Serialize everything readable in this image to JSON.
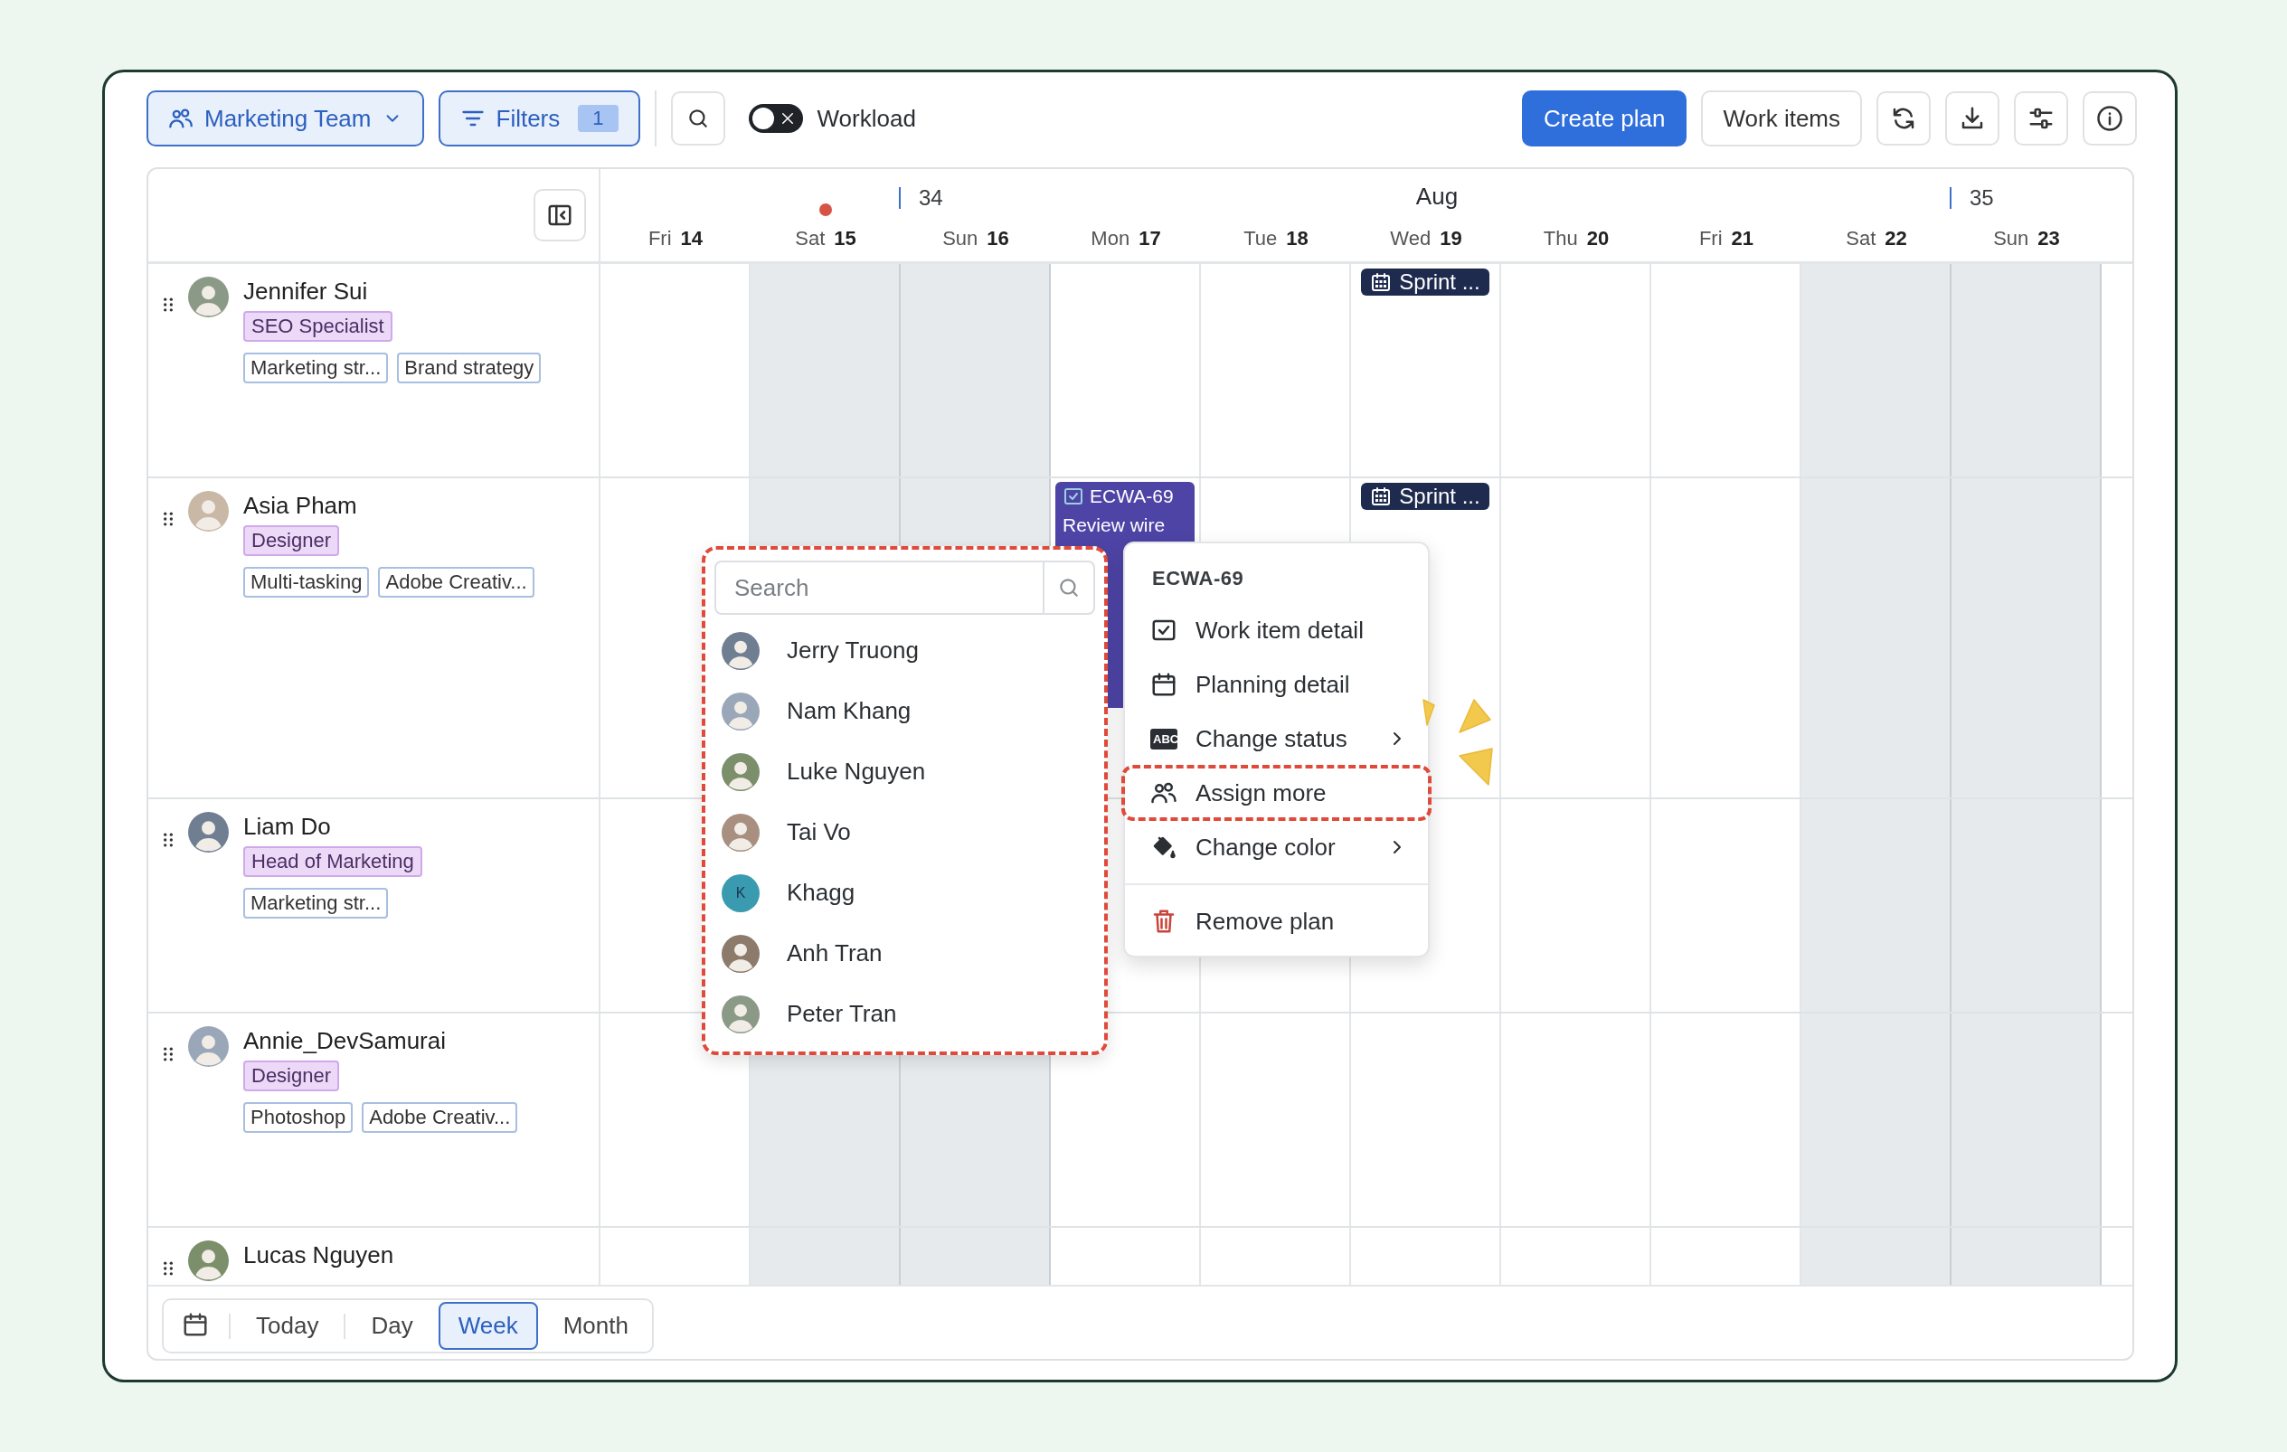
{
  "toolbar": {
    "team": {
      "label": "Marketing Team"
    },
    "filters": {
      "label": "Filters",
      "count": "1"
    },
    "workload": {
      "label": "Workload",
      "on": false
    },
    "actions": [
      {
        "kind": "primary",
        "label": "Create plan"
      },
      {
        "kind": "secondary",
        "label": "Work items"
      },
      {
        "kind": "refresh"
      },
      {
        "kind": "download"
      },
      {
        "kind": "adjust"
      },
      {
        "kind": "info"
      }
    ]
  },
  "timeline": {
    "days": [
      {
        "weekday": "Fri",
        "date": "14",
        "weekend": false,
        "today": false
      },
      {
        "weekday": "Sat",
        "date": "15",
        "weekend": true,
        "today": true
      },
      {
        "weekday": "Sun",
        "date": "16",
        "weekend": true,
        "today": false,
        "week": "34"
      },
      {
        "weekday": "Mon",
        "date": "17",
        "weekend": false,
        "today": false
      },
      {
        "weekday": "Tue",
        "date": "18",
        "weekend": false,
        "today": false
      },
      {
        "weekday": "Wed",
        "date": "19",
        "weekend": false,
        "today": false,
        "month": "Aug"
      },
      {
        "weekday": "Thu",
        "date": "20",
        "weekend": false,
        "today": false
      },
      {
        "weekday": "Fri",
        "date": "21",
        "weekend": false,
        "today": false
      },
      {
        "weekday": "Sat",
        "date": "22",
        "weekend": true,
        "today": false
      },
      {
        "weekday": "Sun",
        "date": "23",
        "weekend": true,
        "today": false,
        "week": "35"
      }
    ]
  },
  "members": [
    {
      "name": "Jennifer Sui",
      "role": "SEO Specialist",
      "skills": [
        "Marketing str...",
        "Brand strategy"
      ],
      "cells": [
        {},
        {},
        {},
        {},
        {},
        {
          "events": [
            {
              "kind": "sprint",
              "label": "Sprint ..."
            }
          ]
        },
        {},
        {},
        {},
        {}
      ]
    },
    {
      "name": "Asia Pham",
      "role": "Designer",
      "skills": [
        "Multi-tasking",
        "Adobe Creativ..."
      ],
      "cells": [
        {},
        {},
        {},
        {
          "events": [
            {
              "kind": "task",
              "code": "ECWA-69",
              "title": "Review wire",
              "done": true
            }
          ]
        },
        {},
        {
          "events": [
            {
              "kind": "sprint",
              "label": "Sprint ..."
            }
          ]
        },
        {},
        {},
        {},
        {}
      ]
    },
    {
      "name": "Liam Do",
      "role": "Head of Marketing",
      "skills": [
        "Marketing str..."
      ]
    },
    {
      "name": "Annie_DevSamurai",
      "role": "Designer",
      "skills": [
        "Photoshop",
        "Adobe Creativ..."
      ]
    },
    {
      "name": "Lucas Nguyen"
    }
  ],
  "views": [
    {
      "label": "Today",
      "selected": false
    },
    {
      "label": "Day",
      "selected": false
    },
    {
      "label": "Week",
      "selected": true
    },
    {
      "label": "Month",
      "selected": false
    }
  ],
  "assign_popup": {
    "search": {
      "placeholder": "Search"
    },
    "people": [
      {
        "name": "Jerry Truong"
      },
      {
        "name": "Nam Khang"
      },
      {
        "name": "Luke Nguyen"
      },
      {
        "name": "Tai Vo"
      },
      {
        "name": "Khagg",
        "initial": "K"
      },
      {
        "name": "Anh Tran"
      },
      {
        "name": "Peter Tran"
      }
    ]
  },
  "context_menu": {
    "title": "ECWA-69",
    "items": [
      {
        "kind": "detail",
        "label": "Work item detail",
        "submenu": false,
        "highlighted": false
      },
      {
        "kind": "planning",
        "label": "Planning detail",
        "submenu": false,
        "highlighted": false
      },
      {
        "kind": "status",
        "label": "Change status",
        "badge": "ABC",
        "submenu": true,
        "highlighted": false
      },
      {
        "kind": "assign",
        "label": "Assign more",
        "submenu": false,
        "highlighted": true
      },
      {
        "kind": "color",
        "label": "Change color",
        "submenu": true,
        "highlighted": false
      },
      {
        "kind": "remove",
        "label": "Remove plan",
        "submenu": false,
        "highlighted": false
      }
    ]
  }
}
